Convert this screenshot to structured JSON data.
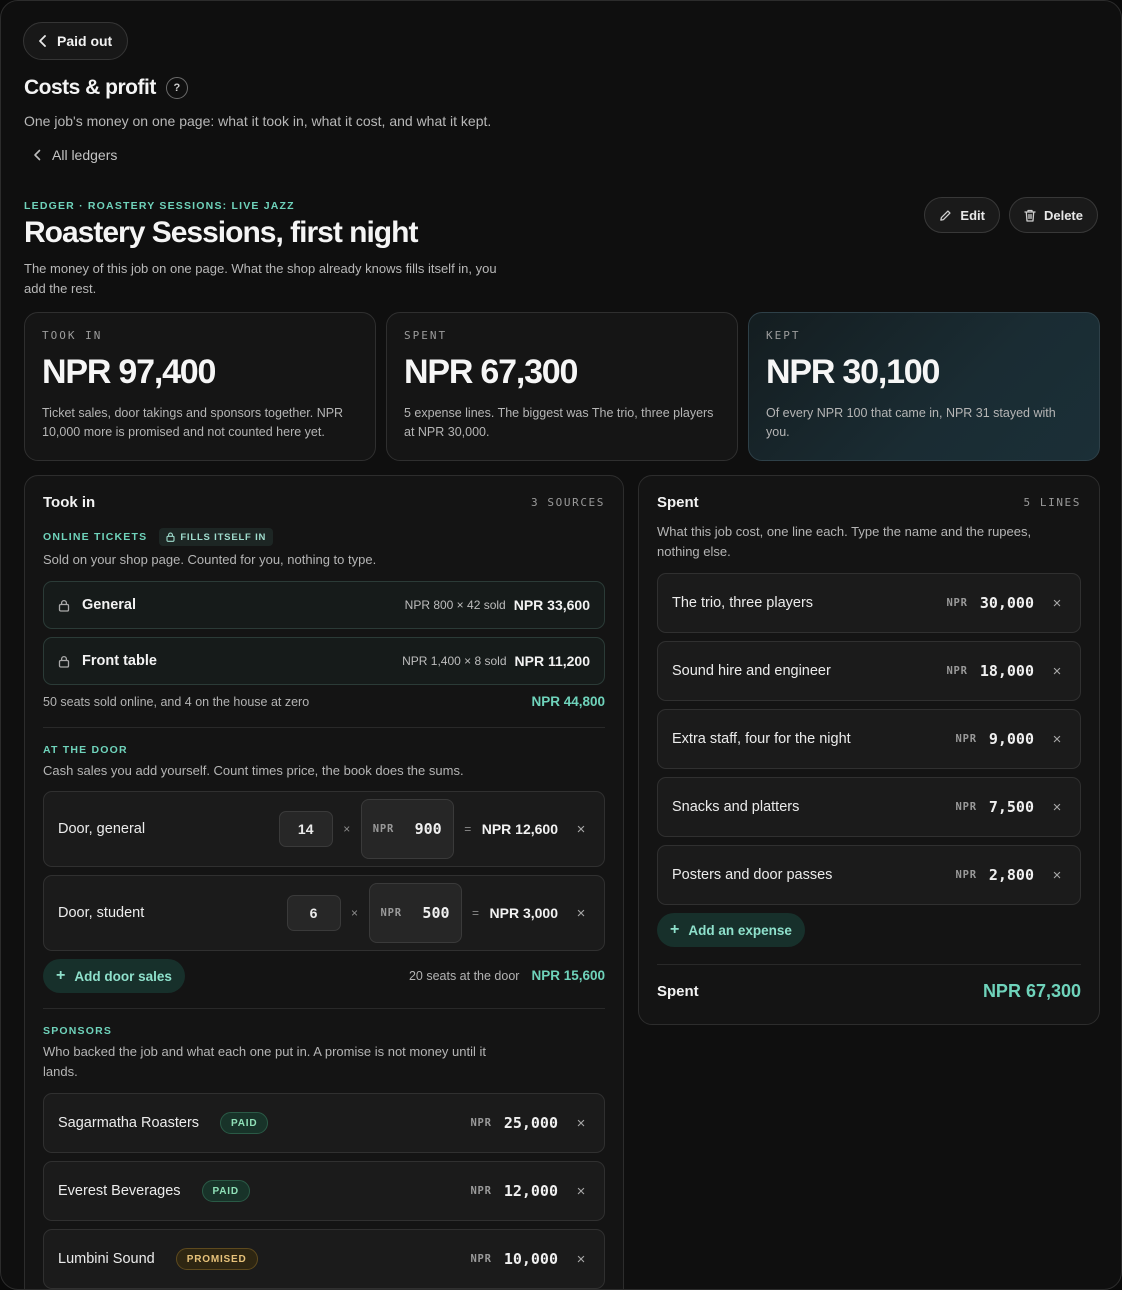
{
  "nav": {
    "back_label": "Paid out",
    "all_ledgers_label": "All ledgers"
  },
  "header": {
    "title": "Costs & profit",
    "help": "?",
    "subtitle": "One job's money on one page: what it took in, what it cost, and what it kept."
  },
  "ledger": {
    "eyebrow": "LEDGER · ROASTERY SESSIONS: LIVE JAZZ",
    "title": "Roastery Sessions, first night",
    "subtitle": "The money of this job on one page. What the shop already knows fills itself in, you add the rest.",
    "edit_label": "Edit",
    "delete_label": "Delete"
  },
  "stats": {
    "took_in": {
      "label": "TOOK IN",
      "value": "NPR 97,400",
      "desc": "Ticket sales, door takings and sponsors together. NPR 10,000 more is promised and not counted here yet."
    },
    "spent": {
      "label": "SPENT",
      "value": "NPR 67,300",
      "desc": "5 expense lines. The biggest was The trio, three players at NPR 30,000."
    },
    "kept": {
      "label": "KEPT",
      "value": "NPR 30,100",
      "desc": "Of every NPR 100 that came in, NPR 31 stayed with you."
    }
  },
  "took_in": {
    "title": "Took in",
    "count": "3 SOURCES",
    "online": {
      "label": "ONLINE TICKETS",
      "badge": "FILLS ITSELF IN",
      "desc": "Sold on your shop page. Counted for you, nothing to type.",
      "rows": [
        {
          "name": "General",
          "calc": "NPR 800 × 42 sold",
          "total": "NPR 33,600"
        },
        {
          "name": "Front table",
          "calc": "NPR 1,400 × 8 sold",
          "total": "NPR 11,200"
        }
      ],
      "subtotal_note": "50 seats sold online, and 4 on the house at zero",
      "subtotal_value": "NPR 44,800"
    },
    "door": {
      "label": "AT THE DOOR",
      "desc": "Cash sales you add yourself. Count times price, the book does the sums.",
      "rows": [
        {
          "name": "Door, general",
          "qty": "14",
          "times": "×",
          "currency": "NPR",
          "price": "900",
          "eq": "=",
          "total": "NPR 12,600"
        },
        {
          "name": "Door, student",
          "qty": "6",
          "times": "×",
          "currency": "NPR",
          "price": "500",
          "eq": "=",
          "total": "NPR 3,000"
        }
      ],
      "add_label": "Add door sales",
      "subtotal_note": "20 seats at the door",
      "subtotal_value": "NPR 15,600"
    },
    "sponsors": {
      "label": "SPONSORS",
      "desc": "Who backed the job and what each one put in. A promise is not money until it lands.",
      "rows": [
        {
          "name": "Sagarmatha Roasters",
          "status": "PAID",
          "currency": "NPR",
          "amount": "25,000"
        },
        {
          "name": "Everest Beverages",
          "status": "PAID",
          "currency": "NPR",
          "amount": "12,000"
        },
        {
          "name": "Lumbini Sound",
          "status": "PROMISED",
          "currency": "NPR",
          "amount": "10,000"
        }
      ]
    }
  },
  "spent": {
    "title": "Spent",
    "count": "5 LINES",
    "desc": "What this job cost, one line each. Type the name and the rupees, nothing else.",
    "rows": [
      {
        "name": "The trio, three players",
        "currency": "NPR",
        "amount": "30,000"
      },
      {
        "name": "Sound hire and engineer",
        "currency": "NPR",
        "amount": "18,000"
      },
      {
        "name": "Extra staff, four for the night",
        "currency": "NPR",
        "amount": "9,000"
      },
      {
        "name": "Snacks and platters",
        "currency": "NPR",
        "amount": "7,500"
      },
      {
        "name": "Posters and door passes",
        "currency": "NPR",
        "amount": "2,800"
      }
    ],
    "add_label": "Add an expense",
    "total_label": "Spent",
    "total_value": "NPR 67,300"
  },
  "icons": {
    "close": "×",
    "plus": "+"
  },
  "colors": {
    "accent": "#6fd3bb",
    "paid": "#8fe0b7",
    "promised": "#e7c27a"
  }
}
